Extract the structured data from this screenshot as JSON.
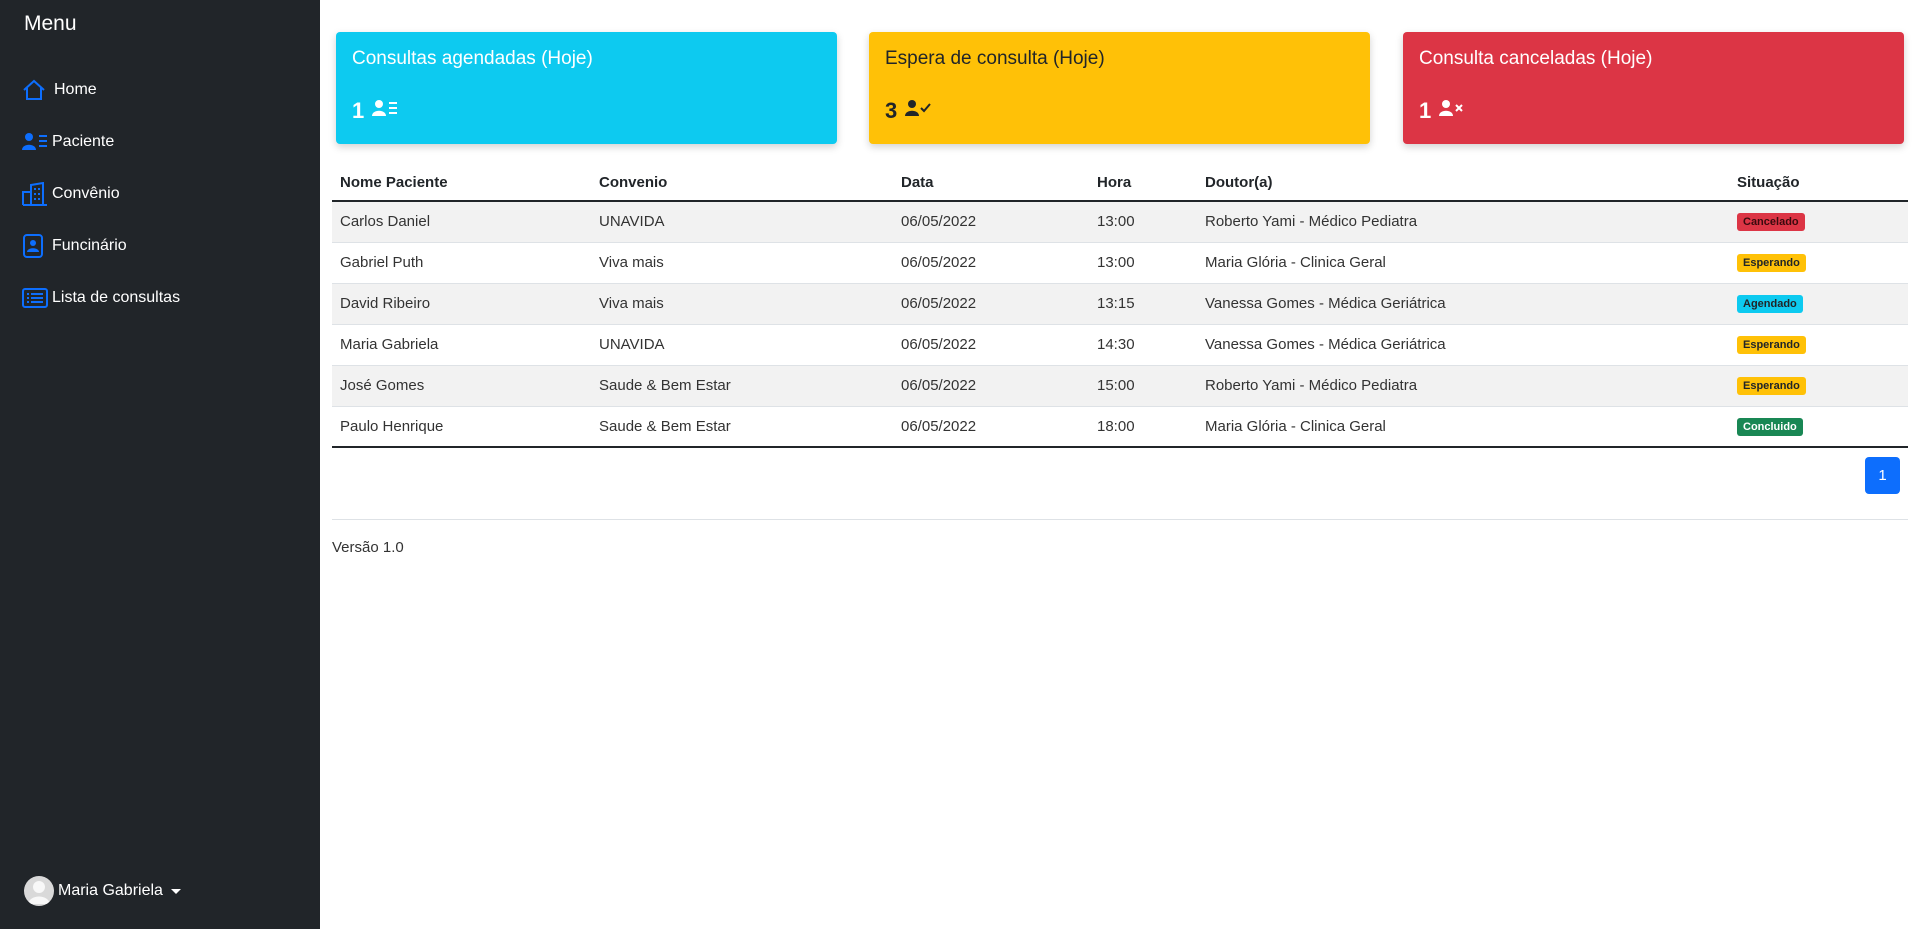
{
  "sidebar": {
    "title": "Menu",
    "items": [
      {
        "label": "Home",
        "icon": "home-icon"
      },
      {
        "label": "Paciente",
        "icon": "patient-list-icon"
      },
      {
        "label": "Convênio",
        "icon": "buildings-icon"
      },
      {
        "label": "Funcinário",
        "icon": "badge-icon"
      },
      {
        "label": "Lista de consultas",
        "icon": "list-icon"
      }
    ],
    "user": {
      "name": "Maria Gabriela"
    }
  },
  "cards": [
    {
      "title": "Consultas agendadas (Hoje)",
      "value": "1",
      "icon": "person-list-icon",
      "color": "#0dcaf0"
    },
    {
      "title": "Espera de consulta (Hoje)",
      "value": "3",
      "icon": "person-check-icon",
      "color": "#ffc107"
    },
    {
      "title": "Consulta canceladas (Hoje)",
      "value": "1",
      "icon": "person-x-icon",
      "color": "#dc3545"
    }
  ],
  "table": {
    "headers": [
      "Nome Paciente",
      "Convenio",
      "Data",
      "Hora",
      "Doutor(a)",
      "Situação"
    ],
    "rows": [
      {
        "nome": "Carlos Daniel",
        "convenio": "UNAVIDA",
        "data": "06/05/2022",
        "hora": "13:00",
        "doutor": "Roberto Yami - Médico Pediatra",
        "situacao": "Cancelado"
      },
      {
        "nome": "Gabriel Puth",
        "convenio": "Viva mais",
        "data": "06/05/2022",
        "hora": "13:00",
        "doutor": "Maria Glória - Clinica Geral",
        "situacao": "Esperando"
      },
      {
        "nome": "David Ribeiro",
        "convenio": "Viva mais",
        "data": "06/05/2022",
        "hora": "13:15",
        "doutor": "Vanessa Gomes - Médica Geriátrica",
        "situacao": "Agendado"
      },
      {
        "nome": "Maria Gabriela",
        "convenio": "UNAVIDA",
        "data": "06/05/2022",
        "hora": "14:30",
        "doutor": "Vanessa Gomes - Médica Geriátrica",
        "situacao": "Esperando"
      },
      {
        "nome": "José Gomes",
        "convenio": "Saude & Bem Estar",
        "data": "06/05/2022",
        "hora": "15:00",
        "doutor": "Roberto Yami - Médico Pediatra",
        "situacao": "Esperando"
      },
      {
        "nome": "Paulo Henrique",
        "convenio": "Saude & Bem Estar",
        "data": "06/05/2022",
        "hora": "18:00",
        "doutor": "Maria Glória - Clinica Geral",
        "situacao": "Concluido"
      }
    ]
  },
  "status_colors": {
    "Cancelado": "#dc3545",
    "Esperando": "#ffc107",
    "Agendado": "#0dcaf0",
    "Concluido": "#198754"
  },
  "pagination": {
    "current": "1"
  },
  "footer": {
    "version": "Versão 1.0"
  }
}
